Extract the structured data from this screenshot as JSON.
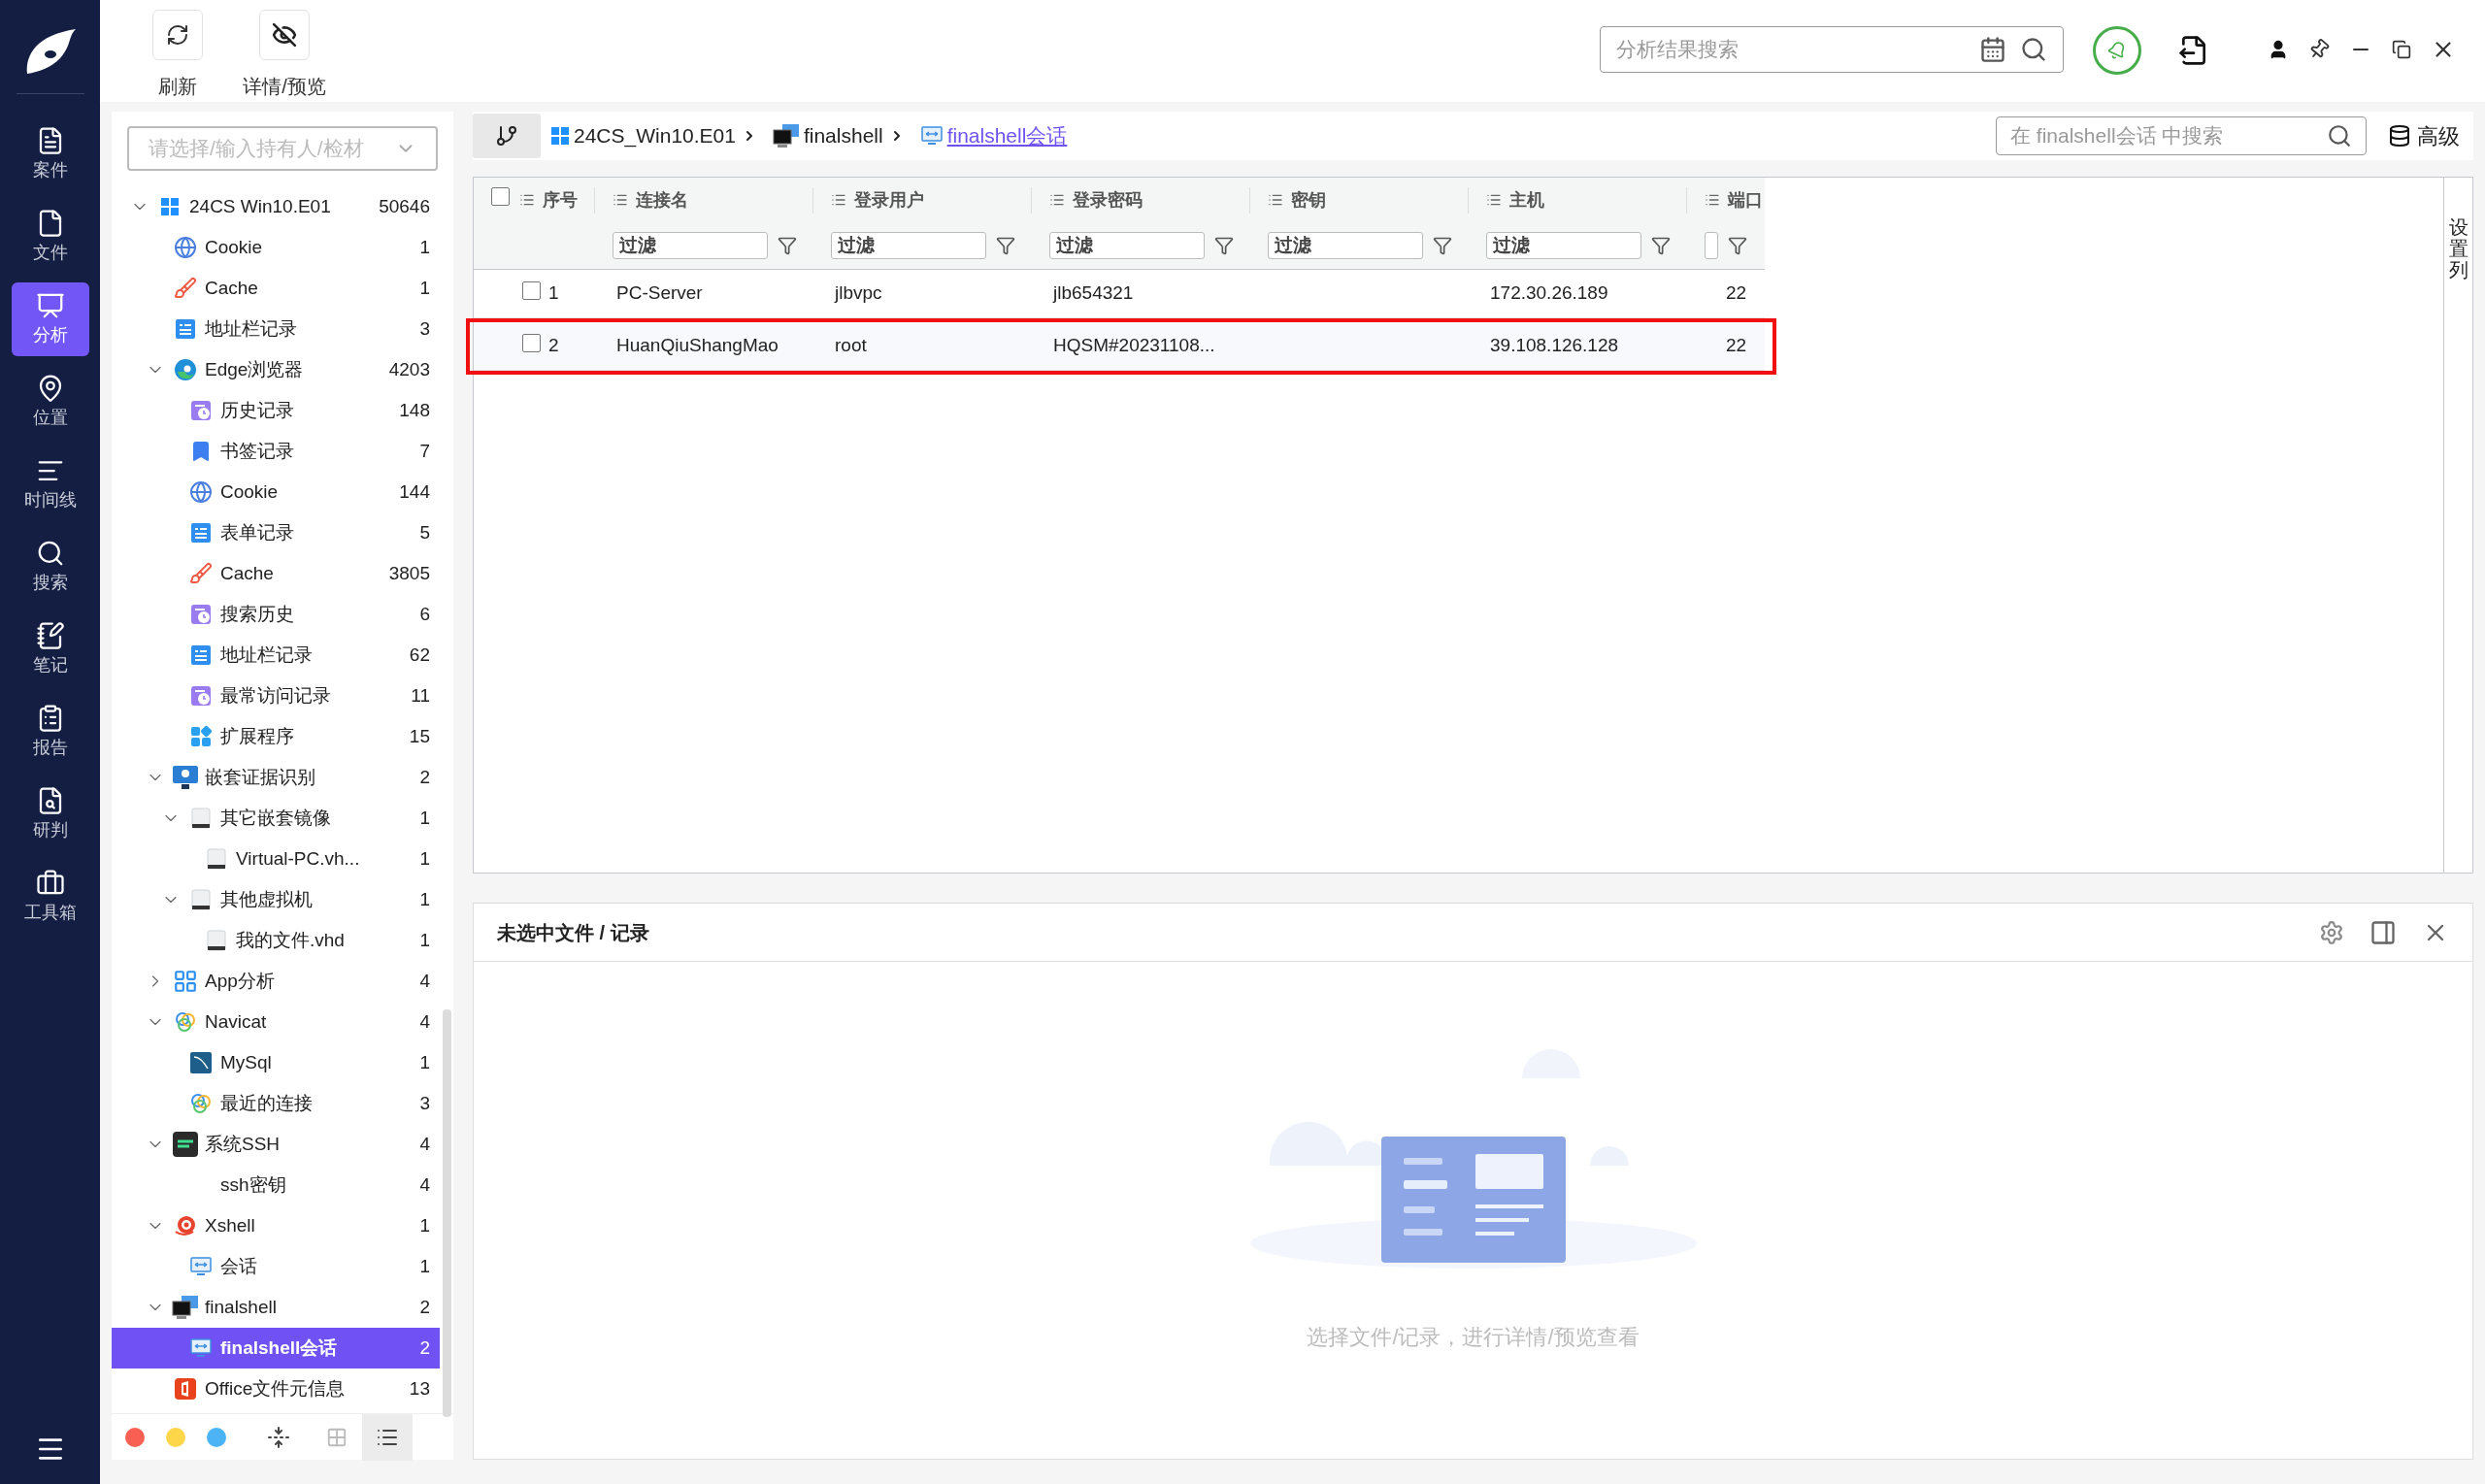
{
  "nav": [
    {
      "label": "案件",
      "kind": "case",
      "selected": false
    },
    {
      "label": "文件",
      "kind": "file",
      "selected": false
    },
    {
      "label": "分析",
      "kind": "analysis",
      "selected": true
    },
    {
      "label": "位置",
      "kind": "location",
      "selected": false
    },
    {
      "label": "时间线",
      "kind": "timeline",
      "selected": false
    },
    {
      "label": "搜索",
      "kind": "search",
      "selected": false
    },
    {
      "label": "笔记",
      "kind": "notes",
      "selected": false
    },
    {
      "label": "报告",
      "kind": "report",
      "selected": false
    },
    {
      "label": "研判",
      "kind": "judge",
      "selected": false
    },
    {
      "label": "工具箱",
      "kind": "toolbox",
      "selected": false
    }
  ],
  "toolbar": [
    {
      "label": "刷新",
      "kind": "refresh"
    },
    {
      "label": "详情/预览",
      "kind": "preview"
    }
  ],
  "global_search": {
    "placeholder": "分析结果搜索"
  },
  "tree_search": {
    "placeholder": "请选择/输入持有人/检材"
  },
  "tree": [
    {
      "label": "24CS  Win10.E01",
      "count": "50646",
      "kind": "windows",
      "expanded": true,
      "selected": false,
      "children": [
        {
          "label": "Cookie",
          "count": "1",
          "kind": "cookie",
          "selected": false
        },
        {
          "label": "Cache",
          "count": "1",
          "kind": "cache",
          "selected": false
        },
        {
          "label": "地址栏记录",
          "count": "3",
          "kind": "address",
          "selected": false
        },
        {
          "label": "Edge浏览器",
          "count": "4203",
          "kind": "edge",
          "expanded": true,
          "selected": false,
          "children": [
            {
              "label": "历史记录",
              "count": "148",
              "kind": "history",
              "selected": false
            },
            {
              "label": "书签记录",
              "count": "7",
              "kind": "bookmark",
              "selected": false
            },
            {
              "label": "Cookie",
              "count": "144",
              "kind": "cookie",
              "selected": false
            },
            {
              "label": "表单记录",
              "count": "5",
              "kind": "address",
              "selected": false
            },
            {
              "label": "Cache",
              "count": "3805",
              "kind": "cache",
              "selected": false
            },
            {
              "label": "搜索历史",
              "count": "6",
              "kind": "history",
              "selected": false
            },
            {
              "label": "地址栏记录",
              "count": "62",
              "kind": "address",
              "selected": false
            },
            {
              "label": "最常访问记录",
              "count": "11",
              "kind": "history",
              "selected": false
            },
            {
              "label": "扩展程序",
              "count": "15",
              "kind": "extension",
              "selected": false
            }
          ]
        },
        {
          "label": "嵌套证据识别",
          "count": "2",
          "kind": "nested",
          "expanded": true,
          "selected": false,
          "children": [
            {
              "label": "其它嵌套镜像",
              "count": "1",
              "kind": "disk",
              "expanded": true,
              "selected": false,
              "children": [
                {
                  "label": "Virtual-PC.vh...",
                  "count": "1",
                  "kind": "disk",
                  "selected": false
                }
              ]
            },
            {
              "label": "其他虚拟机",
              "count": "1",
              "kind": "disk",
              "expanded": true,
              "selected": false,
              "children": [
                {
                  "label": "我的文件.vhd",
                  "count": "1",
                  "kind": "disk",
                  "selected": false
                }
              ]
            }
          ]
        },
        {
          "label": "App分析",
          "count": "4",
          "kind": "apps",
          "expanded": false,
          "selected": false
        },
        {
          "label": "Navicat",
          "count": "4",
          "kind": "navicat",
          "expanded": true,
          "selected": false,
          "children": [
            {
              "label": "MySql",
              "count": "1",
              "kind": "mysql",
              "selected": false
            },
            {
              "label": "最近的连接",
              "count": "3",
              "kind": "navicat",
              "selected": false
            }
          ]
        },
        {
          "label": "系统SSH",
          "count": "4",
          "kind": "ssh",
          "expanded": true,
          "selected": false,
          "children": [
            {
              "label": "ssh密钥",
              "count": "4",
              "kind": "plain",
              "selected": false
            }
          ]
        },
        {
          "label": "Xshell",
          "count": "1",
          "kind": "xshell",
          "expanded": true,
          "selected": false,
          "children": [
            {
              "label": "会话",
              "count": "1",
              "kind": "session",
              "selected": false
            }
          ]
        },
        {
          "label": "finalshell",
          "count": "2",
          "kind": "finalshell",
          "expanded": true,
          "selected": false,
          "children": [
            {
              "label": "finalshell会话",
              "count": "2",
              "kind": "session",
              "selected": true
            }
          ]
        },
        {
          "label": "Office文件元信息",
          "count": "13",
          "kind": "office",
          "selected": false
        }
      ]
    }
  ],
  "color_filters": [
    {
      "color": "#f95f53"
    },
    {
      "color": "#fdd649"
    },
    {
      "color": "#4cb4f5"
    }
  ],
  "view_modes": [
    {
      "kind": "grid",
      "selected": false
    },
    {
      "kind": "list",
      "selected": true
    }
  ],
  "breadcrumb": [
    {
      "label": "24CS_Win10.E01",
      "kind": "windows",
      "selected": false
    },
    {
      "label": "finalshell",
      "kind": "finalshell",
      "selected": false
    },
    {
      "label": "finalshell会话",
      "kind": "session",
      "selected": true
    }
  ],
  "table_search": {
    "placeholder": "在 finalshell会话 中搜索"
  },
  "advanced_button": "高级",
  "table": {
    "select_all_checked": false,
    "columns": [
      {
        "label": "序号"
      },
      {
        "label": "连接名",
        "filter_placeholder": "过滤"
      },
      {
        "label": "登录用户",
        "filter_placeholder": "过滤"
      },
      {
        "label": "登录密码",
        "filter_placeholder": "过滤"
      },
      {
        "label": "密钥",
        "filter_placeholder": "过滤"
      },
      {
        "label": "主机",
        "filter_placeholder": "过滤"
      },
      {
        "label": "端口"
      }
    ],
    "rows": [
      {
        "checked": false,
        "marked": false,
        "cells": [
          "1",
          "PC-Server",
          "jlbvpc",
          "jlb654321",
          "",
          "172.30.26.189",
          "22"
        ]
      },
      {
        "checked": false,
        "marked": true,
        "cells": [
          "2",
          "HuanQiuShangMao",
          "root",
          "HQSM#20231108...",
          "",
          "39.108.126.128",
          "22"
        ]
      }
    ]
  },
  "column_settings": "设置列",
  "detail_panel": {
    "title": "未选中文件 / 记录",
    "empty_text": "选择文件/记录，进行详情/预览查看"
  }
}
